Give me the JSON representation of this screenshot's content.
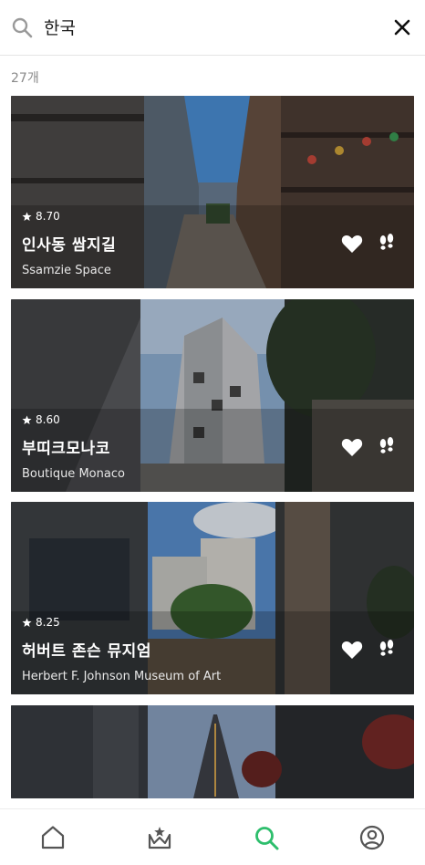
{
  "search": {
    "query": "한국"
  },
  "results": {
    "count_label": "27개",
    "cards": [
      {
        "rating": "8.70",
        "name": "인사동 쌈지길",
        "subname": "Ssamzie Space"
      },
      {
        "rating": "8.60",
        "name": "부띠크모나코",
        "subname": "Boutique Monaco"
      },
      {
        "rating": "8.25",
        "name": "허버트 존슨 뮤지엄",
        "subname": "Herbert F. Johnson Museum of Art"
      }
    ]
  },
  "icons": {
    "search": "search-icon",
    "clear": "close-icon",
    "rating": "star-icon",
    "like": "heart-icon",
    "visited": "footsteps-icon",
    "nav_home": "home-icon",
    "nav_ranking": "crown-icon",
    "nav_search": "search-icon",
    "nav_profile": "profile-icon"
  },
  "colors": {
    "accent": "#2dbe6c",
    "icon_dark": "#555555",
    "text_muted": "#8a8a8a"
  }
}
